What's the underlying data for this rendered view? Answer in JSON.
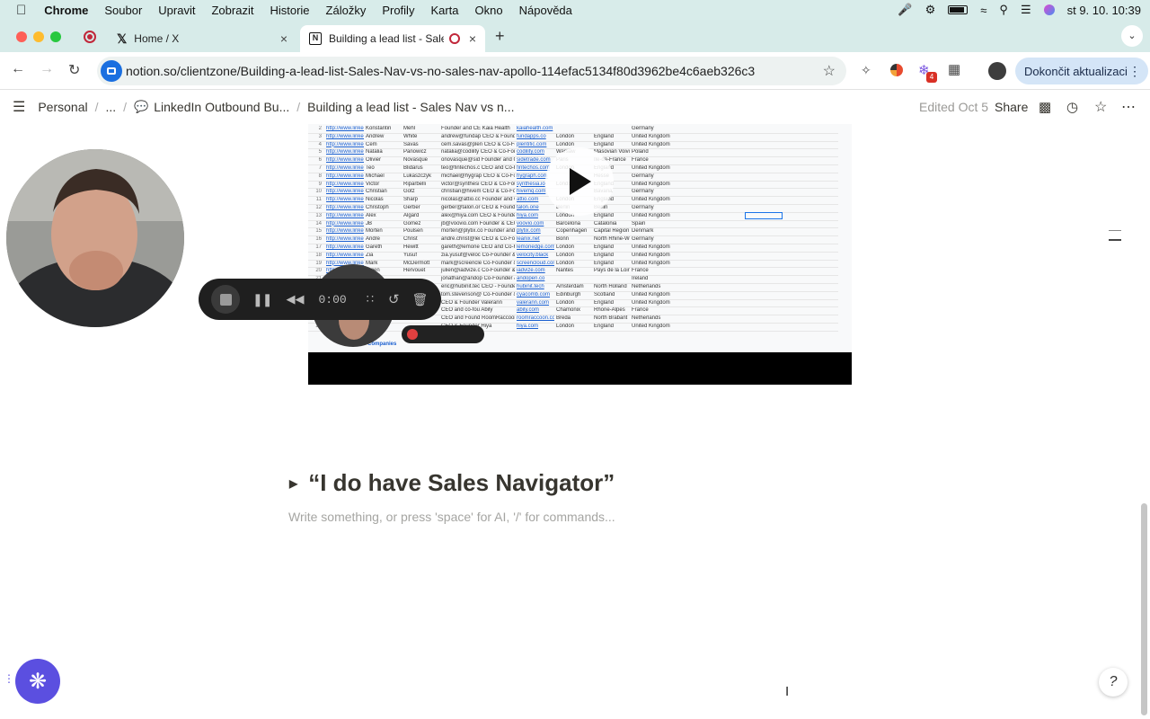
{
  "menubar": {
    "app": "Chrome",
    "items": [
      "Soubor",
      "Upravit",
      "Zobrazit",
      "Historie",
      "Záložky",
      "Profily",
      "Karta",
      "Okno",
      "Nápověda"
    ],
    "clock": "st 9. 10.  10:39"
  },
  "tabs": [
    {
      "title": "Home / X"
    },
    {
      "title": "Building a lead list - Sales"
    }
  ],
  "toolbar": {
    "url": "notion.so/clientzone/Building-a-lead-list-Sales-Nav-vs-no-sales-nav-apollo-114efac5134f80d3962be4c6aeb326c3",
    "update_label": "Dokončit aktualizaci",
    "badge_count": "4"
  },
  "notion": {
    "breadcrumb": [
      "Personal",
      "...",
      "LinkedIn Outbound Bu...",
      "Building a lead list - Sales Nav vs n..."
    ],
    "edited": "Edited Oct 5",
    "share": "Share"
  },
  "recorder": {
    "time": "0:00"
  },
  "sheet": {
    "rows": [
      [
        "2",
        "http://www.linkec",
        "Konstantin",
        "Mehl",
        "Founder and CE Kaia Health",
        "kaiahealth.com",
        "",
        "",
        "Germany"
      ],
      [
        "3",
        "http://www.linkec",
        "Andrew",
        "White",
        "andrew@fundap CEO & Founder FundApps",
        "fundapps.co",
        "London",
        "England",
        "United Kingdom"
      ],
      [
        "4",
        "http://www.linkec",
        "Cem",
        "Savas",
        "cem.savas@plen CEO & Co-Foun Plentific",
        "plentific.com",
        "London",
        "England",
        "United Kingdom"
      ],
      [
        "5",
        "http://www.linkec",
        "Natalia",
        "Panowicz",
        "natalia@codility CEO & Co-Foun Codility",
        "codility.com",
        "Warsaw",
        "Masovian Voivo",
        "Poland"
      ],
      [
        "6",
        "http://www.linkec",
        "Olivier",
        "Novasque",
        "onovasque@sid Founder and CE Sidetrade",
        "sidetrade.com",
        "Paris",
        "Île-de-France",
        "France"
      ],
      [
        "7",
        "http://www.linkec",
        "Teo",
        "Blidarus",
        "teo@fintechos.c CEO and Co-Fo FintechOS",
        "fintechos.com",
        "London",
        "England",
        "United Kingdom"
      ],
      [
        "8",
        "http://www.linkec",
        "Michael",
        "Lukaszczyk",
        "michael@hygrap CEO & Co-Founc Hygraph",
        "hygraph.com",
        "",
        "Hesse",
        "Germany"
      ],
      [
        "9",
        "http://www.linkec",
        "Victor",
        "Riparbelli",
        "victor@synthesi CEO & Co-Founc Synthesia",
        "synthesia.io",
        "London",
        "England",
        "United Kingdom"
      ],
      [
        "10",
        "http://www.linkec",
        "Christian",
        "Gotz",
        "christian@hivem CEO & Co-Founc HiveMQ",
        "hivemq.com",
        "",
        "Bavaria",
        "Germany"
      ],
      [
        "11",
        "http://www.linkec",
        "Nicolas",
        "Sharp",
        "nicolas@attio.cc Founder and CE Attio",
        "attio.com",
        "London",
        "England",
        "United Kingdom"
      ],
      [
        "12",
        "http://www.linkec",
        "Christoph",
        "Gerber",
        "gerber@talon.or CEO & Founder Talon.One",
        "talon.one",
        "Berlin",
        "Berlin",
        "Germany"
      ],
      [
        "13",
        "http://www.linkec",
        "Alex",
        "Algard",
        "alex@hiya.com CEO & Founder Hiya",
        "hiya.com",
        "London",
        "England",
        "United Kingdom"
      ],
      [
        "14",
        "http://www.linkec",
        "JB",
        "Gomez",
        "jb@voovio.com Founder & CEO Voovio",
        "voovio.com",
        "Barcelona",
        "Catalonia",
        "Spain"
      ],
      [
        "15",
        "http://www.linkec",
        "Morten",
        "Poulsen",
        "morten@plytix.co Founder and CE Plytix PIM",
        "plytix.com",
        "Copenhagen",
        "Capital Region c",
        "Denmark"
      ],
      [
        "16",
        "http://www.linkec",
        "Andre",
        "Christ",
        "andre.christ@lei CEO & Co-Founc LeanIX",
        "leanix.net",
        "Bonn",
        "North Rhine-We",
        "Germany"
      ],
      [
        "17",
        "http://www.linkec",
        "Gareth",
        "Hewitt",
        "gareth@lemone CEO and Co-Fo LemonEdge",
        "lemonedge.com",
        "London",
        "England",
        "United Kingdom"
      ],
      [
        "18",
        "http://www.linkec",
        "Zia",
        "Yusuf",
        "zia.yusuf@veloc Co-Founder & C Velocity Black",
        "velocity.black",
        "London",
        "England",
        "United Kingdom"
      ],
      [
        "19",
        "http://www.linkec",
        "Mark",
        "McDermott",
        "mark@screencle Co-Founder & C ScreenCloud",
        "screencloud.com",
        "London",
        "England",
        "United Kingdom"
      ],
      [
        "20",
        "http://www.linkec",
        "Julien",
        "Hervouet",
        "julien@iadvize.c Co-Founder & C iAdvize",
        "iadvize.com",
        "Nantes",
        "Pays de la Loire",
        "France"
      ],
      [
        "21",
        "",
        "",
        "",
        "jonathan@andop Co-Founder & C &Open",
        "andopen.co",
        "",
        "",
        "Ireland"
      ],
      [
        "22",
        "",
        "",
        "",
        "eric@hubinit.tec CEO - Founder hubinit",
        "hubinit.tech",
        "Amsterdam",
        "North Holland",
        "Netherlands"
      ],
      [
        "23",
        "",
        "",
        "",
        "tom.stevenson@ Co-Founder & C Cyacomb",
        "cyacomb.com",
        "Edinburgh",
        "Scotland",
        "United Kingdom"
      ],
      [
        "24",
        "",
        "",
        "",
        "CEO & Founder Valerann",
        "valerann.com",
        "London",
        "England",
        "United Kingdom"
      ],
      [
        "25",
        "",
        "",
        "",
        "CEO and co-fou Abily",
        "abily.com",
        "Chamonix",
        "Rhone-Alpes",
        "France"
      ],
      [
        "26",
        "",
        "",
        "",
        "CEO and Found RoomRaccoon R",
        "roomraccoon.co",
        "Breda",
        "North Brabant",
        "Netherlands"
      ],
      [
        "27",
        "",
        "",
        "",
        "CEO & Founder Hiya",
        "hiya.com",
        "London",
        "England",
        "United Kingdom"
      ]
    ],
    "sheet_tab": "Companies"
  },
  "content": {
    "toggle_heading": "“I do have Sales Navigator”",
    "placeholder": "Write something, or press 'space' for AI, '/' for commands..."
  }
}
